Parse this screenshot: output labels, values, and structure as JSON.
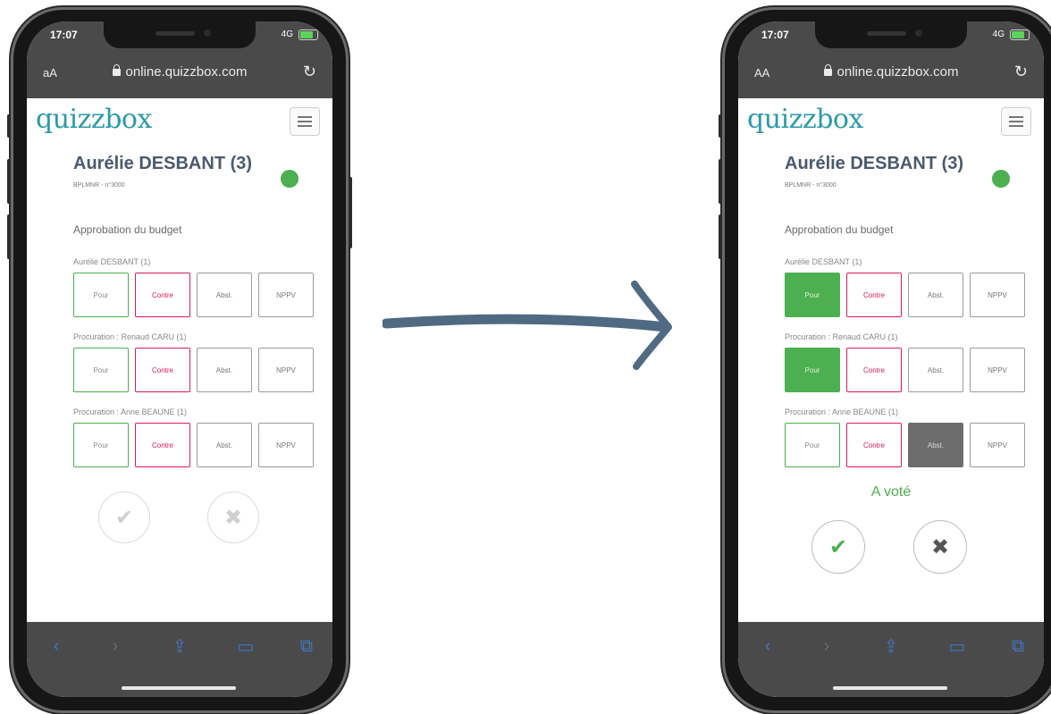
{
  "phones": [
    {
      "status": {
        "time": "17:07",
        "network": "4G"
      },
      "browser": {
        "aa": "aA",
        "url": "online.quizzbox.com"
      },
      "logo": "quizzbox",
      "voter": {
        "name": "Aurélie DESBANT (3)",
        "sub": "BPLMNR - n°3000"
      },
      "question": "Approbation du budget",
      "groups": [
        {
          "label": "Aurélie DESBANT (1)",
          "selected": ""
        },
        {
          "label": "Procuration : Renaud CARU (1)",
          "selected": ""
        },
        {
          "label": "Procuration : Anne BEAUNE (1)",
          "selected": ""
        }
      ],
      "options": {
        "pour": "Pour",
        "contre": "Contre",
        "abst": "Abst.",
        "nppv": "NPPV"
      },
      "voted_message": "",
      "confirm_icon": "✔",
      "cancel_icon": "✖"
    },
    {
      "status": {
        "time": "17:07",
        "network": "4G"
      },
      "browser": {
        "aa": "AA",
        "url": "online.quizzbox.com"
      },
      "logo": "quizzbox",
      "voter": {
        "name": "Aurélie DESBANT (3)",
        "sub": "BPLMNR - n°3000"
      },
      "question": "Approbation du budget",
      "groups": [
        {
          "label": "Aurélie DESBANT (1)",
          "selected": "pour"
        },
        {
          "label": "Procuration : Renaud CARU (1)",
          "selected": "pour"
        },
        {
          "label": "Procuration : Anne BEAUNE (1)",
          "selected": "abst"
        }
      ],
      "options": {
        "pour": "Pour",
        "contre": "Contre",
        "abst": "Abst.",
        "nppv": "NPPV"
      },
      "voted_message": "A voté",
      "confirm_icon": "✔",
      "cancel_icon": "✖"
    }
  ],
  "toolbar_icons": [
    "chevron-left-icon",
    "chevron-right-icon",
    "share-icon",
    "bookmarks-icon",
    "tabs-icon"
  ],
  "colors": {
    "pour": "#4caf50",
    "contre": "#d81b60",
    "abst_selected": "#6d6d6d",
    "logo": "#2e9aa8",
    "arrow": "#4f6a82"
  }
}
